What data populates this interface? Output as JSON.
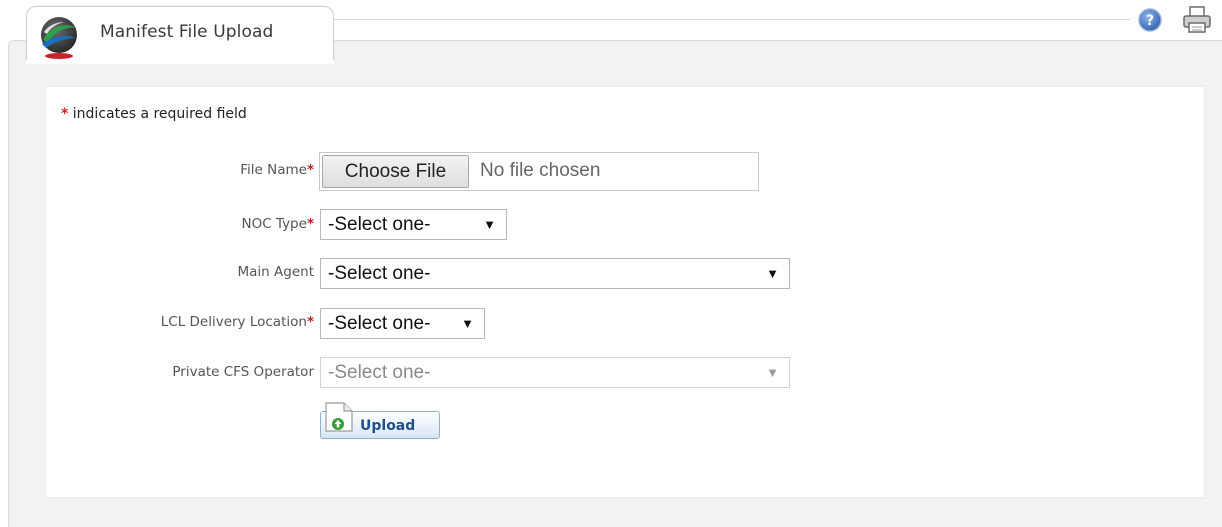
{
  "header": {
    "title": "Manifest File Upload",
    "logo_icon": "dp-world-globe-logo",
    "help_icon": "help-icon",
    "print_icon": "print-icon"
  },
  "form": {
    "required_star": "*",
    "required_note": " indicates a required field",
    "fields": [
      {
        "label": "File Name",
        "required": true
      },
      {
        "label": "NOC Type",
        "required": true
      },
      {
        "label": "Main Agent",
        "required": false
      },
      {
        "label": "LCL Delivery Location",
        "required": true
      },
      {
        "label": "Private CFS Operator",
        "required": false
      }
    ],
    "file": {
      "button_label": "Choose File",
      "status": "No file chosen"
    },
    "noc_type": {
      "value": "-Select one-",
      "arrow": "▼"
    },
    "main_agent": {
      "value": "-Select one-",
      "arrow": "▼"
    },
    "lcl_delivery_location": {
      "value": "-Select one-",
      "arrow": "▼"
    },
    "private_cfs_operator": {
      "value": "-Select one-",
      "arrow": "▼",
      "disabled": true
    },
    "upload_label": "Upload"
  },
  "colors": {
    "required": "#d21f1f",
    "upload_text": "#1f4f8c",
    "panel_bg": "#f2f2f2"
  }
}
